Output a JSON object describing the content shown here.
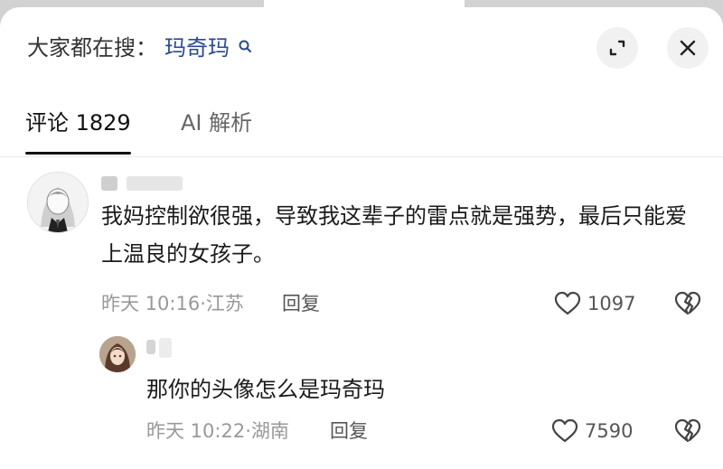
{
  "search": {
    "prefix": "大家都在搜：",
    "term": "玛奇玛",
    "icon": "search-icon"
  },
  "header_actions": [
    {
      "icon": "expand-icon"
    },
    {
      "icon": "close-icon"
    }
  ],
  "tabs": [
    {
      "label": "评论 1829",
      "active": true
    },
    {
      "label": "AI 解析",
      "active": false
    }
  ],
  "comments": [
    {
      "text": "我妈控制欲很强，导致我这辈子的雷点就是强势，最后只能爱上温良的女孩子。",
      "time": "昨天 10:16",
      "location": "江苏",
      "reply_label": "回复",
      "likes": "1097",
      "avatar_icon": "avatar-manga-girl"
    },
    {
      "text": "那你的头像怎么是玛奇玛",
      "time": "昨天 10:22",
      "location": "湖南",
      "reply_label": "回复",
      "likes": "7590",
      "avatar_icon": "avatar-anime-girl"
    }
  ],
  "colors": {
    "search_term": "#2a4a8f",
    "meta_text": "#999999",
    "background": "#ffffff"
  }
}
